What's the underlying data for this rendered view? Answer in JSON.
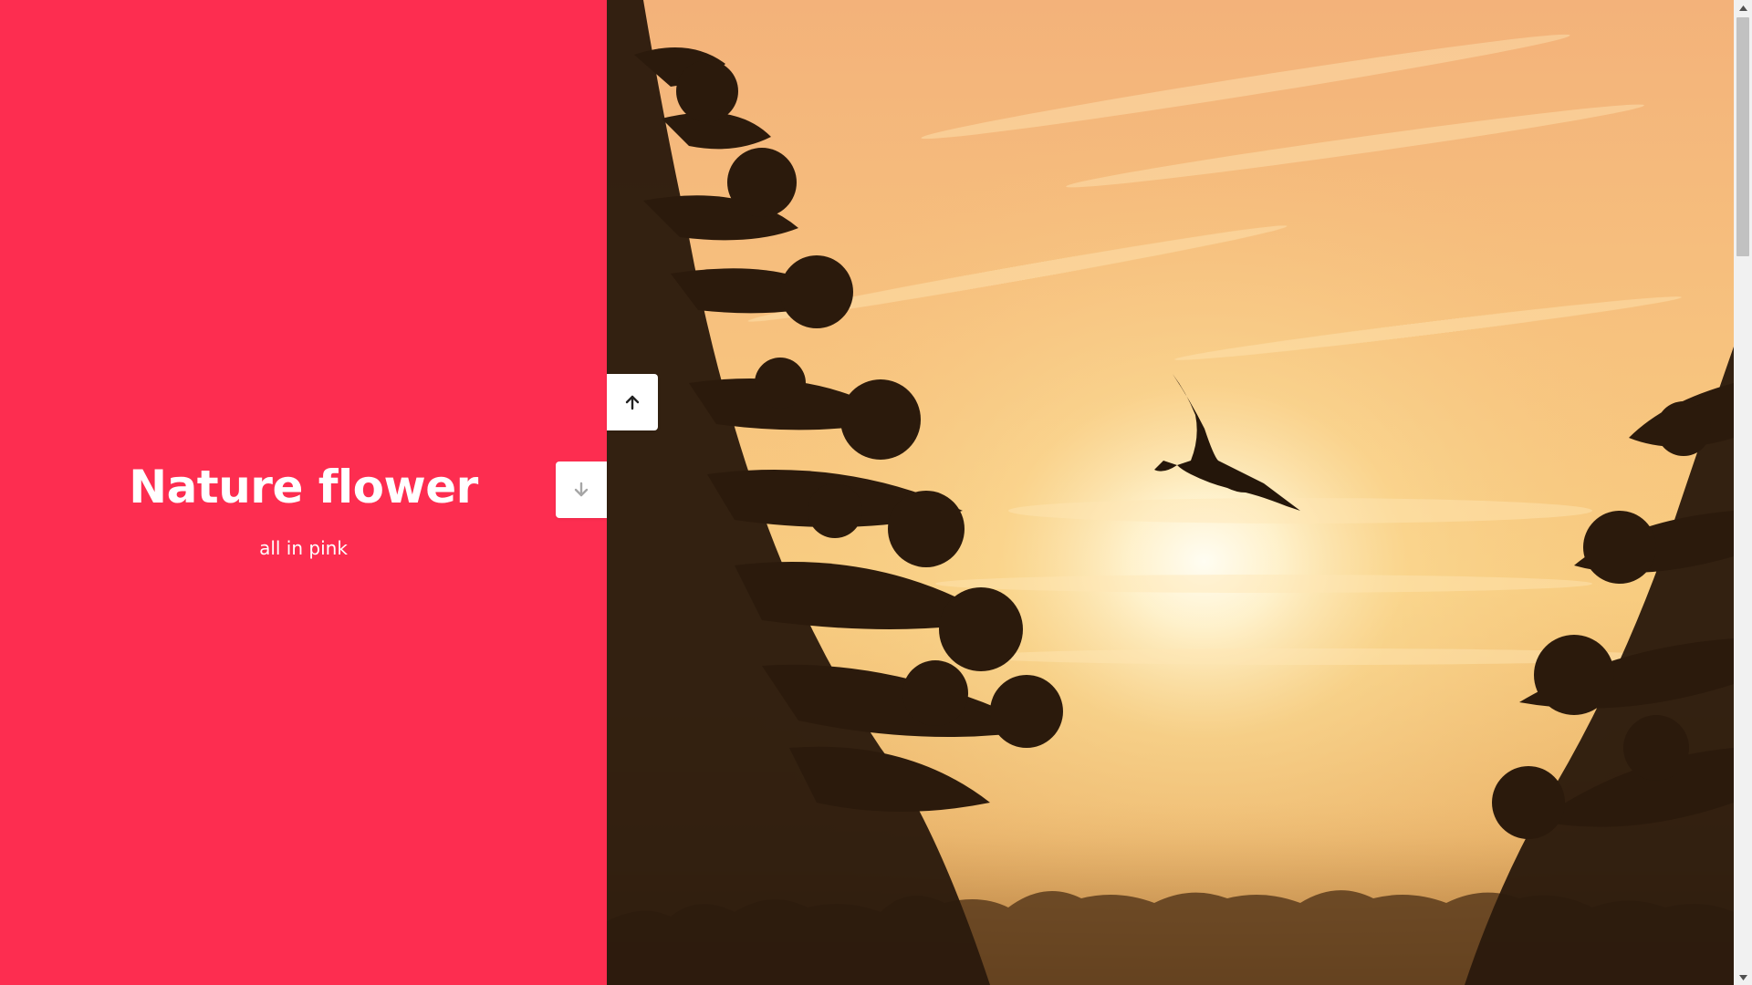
{
  "slide": {
    "title": "Nature flower",
    "subtitle": "all in pink"
  },
  "colors": {
    "panel_background": "#fd2d50",
    "button_background": "#ffffff",
    "up_arrow_color": "#222222",
    "down_arrow_color": "#a6a6a6"
  },
  "image": {
    "description_icon": "sunset-bird-photo"
  },
  "controls": {
    "up_icon": "arrow-up-icon",
    "down_icon": "arrow-down-icon"
  },
  "scrollbar": {
    "position_fraction": 0
  }
}
